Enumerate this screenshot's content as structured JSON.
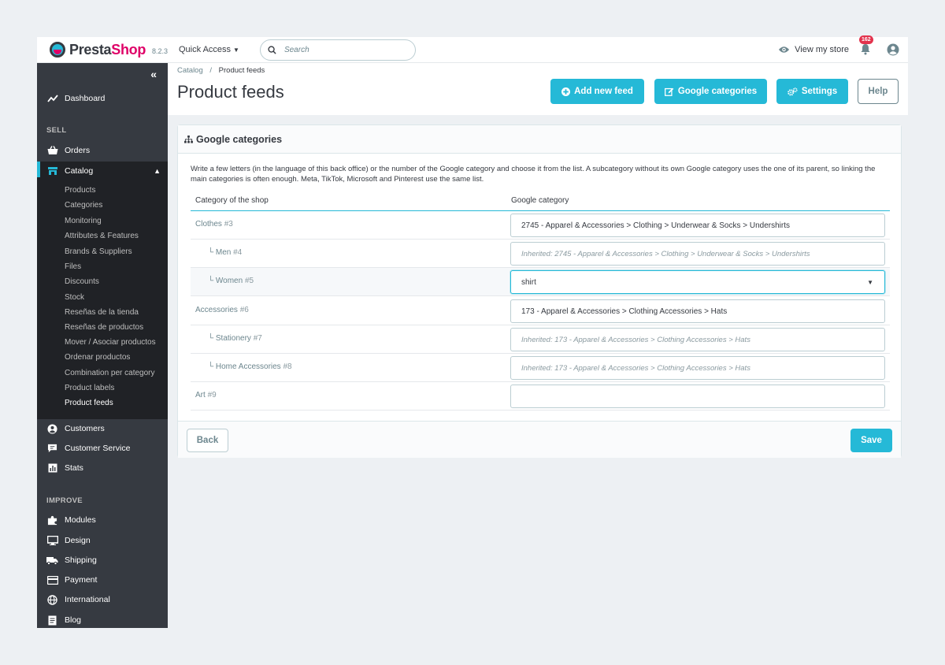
{
  "header": {
    "brand_prefix": "Presta",
    "brand_suffix": "Shop",
    "version": "8.2.3",
    "quick_access": "Quick Access",
    "search_placeholder": "Search",
    "view_store": "View my store",
    "notifications_count": "162"
  },
  "sidebar": {
    "dashboard": "Dashboard",
    "sell_title": "SELL",
    "orders": "Orders",
    "catalog": "Catalog",
    "catalog_sub": [
      "Products",
      "Categories",
      "Monitoring",
      "Attributes & Features",
      "Brands & Suppliers",
      "Files",
      "Discounts",
      "Stock",
      "Reseñas de la tienda",
      "Reseñas de productos",
      "Mover / Asociar productos",
      "Ordenar productos",
      "Combination per category",
      "Product labels",
      "Product feeds"
    ],
    "customers": "Customers",
    "customer_service": "Customer Service",
    "stats": "Stats",
    "improve_title": "IMPROVE",
    "modules": "Modules",
    "design": "Design",
    "shipping": "Shipping",
    "payment": "Payment",
    "international": "International",
    "blog": "Blog"
  },
  "page": {
    "breadcrumb_parent": "Catalog",
    "breadcrumb_sep": "/",
    "breadcrumb_current": "Product feeds",
    "title": "Product feeds",
    "btn_add_feed": "Add new feed",
    "btn_google_categories": "Google categories",
    "btn_settings": "Settings",
    "btn_help": "Help"
  },
  "card": {
    "title": "Google categories",
    "description": "Write a few letters (in the language of this back office) or the number of the Google category and choose it from the list. A subcategory without its own Google category uses the one of its parent, so linking the main categories is often enough. Meta, TikTok, Microsoft and Pinterest use the same list.",
    "col_shop": "Category of the shop",
    "col_google": "Google category",
    "rows": [
      {
        "prefix": "",
        "name": "Clothes",
        "num": "#3",
        "value": "2745 - Apparel & Accessories > Clothing > Underwear & Socks > Undershirts",
        "placeholder": ""
      },
      {
        "prefix": "└",
        "name": "Men",
        "num": "#4",
        "value": "",
        "placeholder": "Inherited: 2745 - Apparel & Accessories > Clothing > Underwear & Socks > Undershirts"
      },
      {
        "prefix": "└",
        "name": "Women",
        "num": "#5",
        "value": "shirt",
        "placeholder": ""
      },
      {
        "prefix": "",
        "name": "Accessories",
        "num": "#6",
        "value": "173 - Apparel & Accessories > Clothing Accessories > Hats",
        "placeholder": ""
      },
      {
        "prefix": "└",
        "name": "Stationery",
        "num": "#7",
        "value": "",
        "placeholder": "Inherited: 173 - Apparel & Accessories > Clothing Accessories > Hats"
      },
      {
        "prefix": "└",
        "name": "Home Accessories",
        "num": "#8",
        "value": "",
        "placeholder": "Inherited: 173 - Apparel & Accessories > Clothing Accessories > Hats"
      },
      {
        "prefix": "",
        "name": "Art",
        "num": "#9",
        "value": "",
        "placeholder": ""
      }
    ],
    "back": "Back",
    "save": "Save"
  },
  "colors": {
    "accent": "#25b9d7",
    "sidebar": "#363a41",
    "brand_pink": "#df0067",
    "badge": "#e3334d"
  },
  "icons": [
    "logo-mark",
    "caret-down-icon",
    "search-icon",
    "eye-icon",
    "bell-icon",
    "user-icon",
    "collapse-icon",
    "chart-line-icon",
    "basket-icon",
    "store-icon",
    "chevron-up-icon",
    "user-circle-icon",
    "chat-icon",
    "bar-chart-icon",
    "puzzle-icon",
    "monitor-icon",
    "truck-icon",
    "credit-card-icon",
    "globe-icon",
    "document-icon",
    "plus-circle-icon",
    "edit-icon",
    "cogs-icon",
    "sitemap-icon",
    "dropdown-arrow-icon"
  ]
}
